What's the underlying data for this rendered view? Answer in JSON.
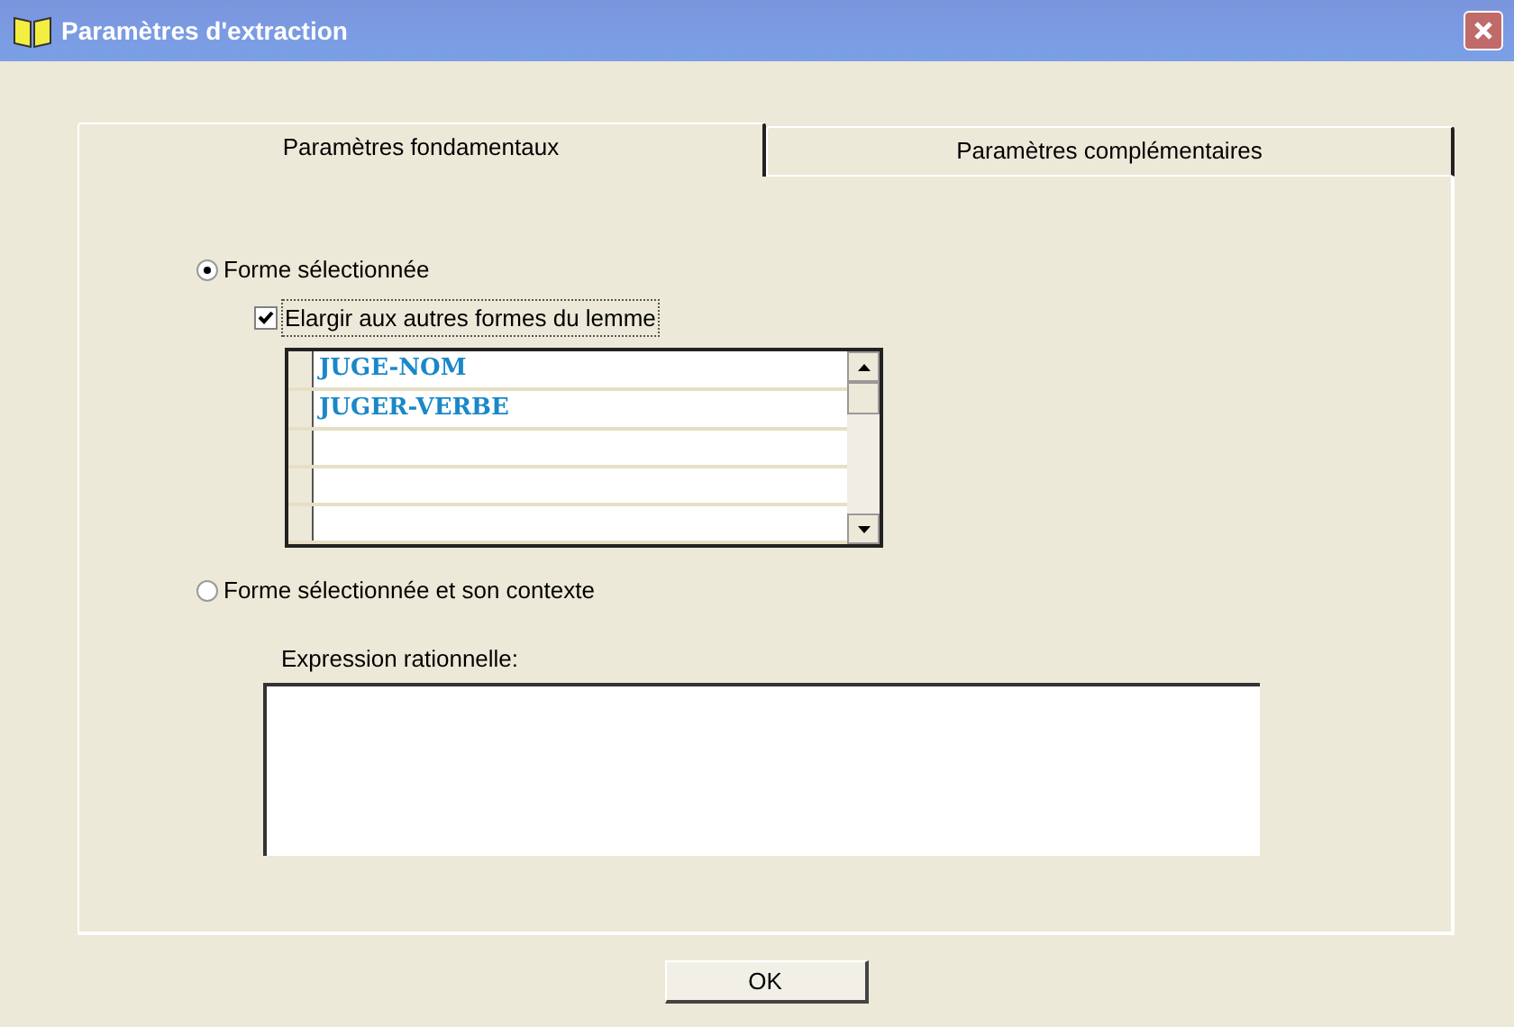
{
  "window": {
    "title": "Paramètres d'extraction"
  },
  "tabs": [
    {
      "label": "Paramètres fondamentaux",
      "selected": true
    },
    {
      "label": "Paramètres complémentaires",
      "selected": false
    }
  ],
  "options": [
    {
      "kind": "radio",
      "label": "Forme sélectionnée",
      "selected": true
    },
    {
      "kind": "checkbox",
      "label": "Elargir aux autres formes du lemme",
      "checked": true,
      "focused": true
    },
    {
      "kind": "list",
      "rows": [
        "JUGE-NOM",
        "JUGER-VERBE"
      ]
    },
    {
      "kind": "radio",
      "label": "Forme sélectionnée et son contexte",
      "selected": false
    },
    {
      "kind": "textarea",
      "label": "Expression rationnelle:"
    }
  ],
  "buttons": [
    "OK"
  ]
}
